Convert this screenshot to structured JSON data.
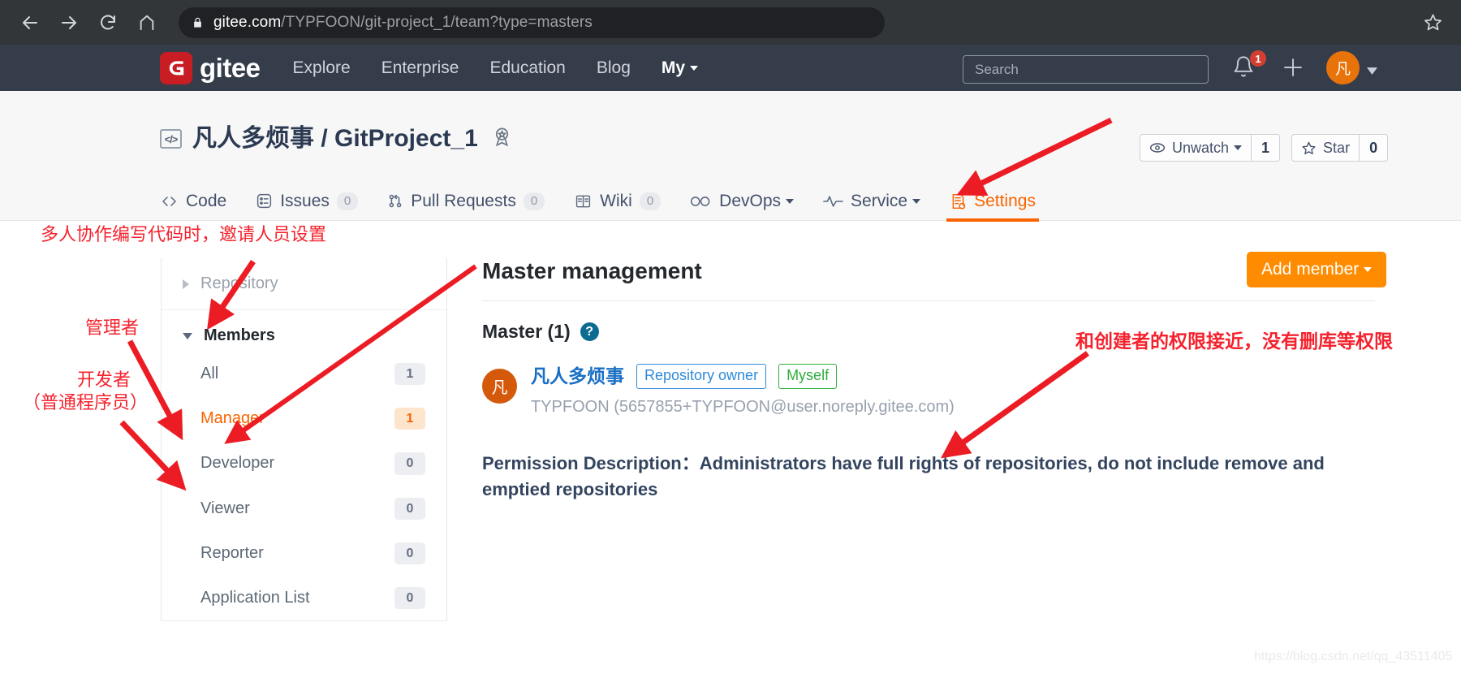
{
  "browser": {
    "url_host": "gitee.com",
    "url_path": "/TYPFOON/git-project_1/team?type=masters",
    "back_icon": "back-arrow-icon",
    "forward_icon": "forward-arrow-icon",
    "reload_icon": "reload-icon",
    "home_icon": "home-icon",
    "lock_icon": "lock-icon",
    "bookmark_icon": "star-outline-icon"
  },
  "header": {
    "logo_text": "gitee",
    "nav": [
      {
        "label": "Explore",
        "bold": false,
        "caret": false
      },
      {
        "label": "Enterprise",
        "bold": false,
        "caret": false
      },
      {
        "label": "Education",
        "bold": false,
        "caret": false
      },
      {
        "label": "Blog",
        "bold": false,
        "caret": false
      },
      {
        "label": "My",
        "bold": true,
        "caret": true
      }
    ],
    "search_placeholder": "Search",
    "search_value": "",
    "notification_count": "1",
    "avatar_initial": "凡"
  },
  "repo": {
    "owner": "凡人多烦事",
    "separator": " / ",
    "name": "GitProject_1",
    "watch_label": "Unwatch",
    "watch_count": "1",
    "star_label": "Star",
    "star_count": "0"
  },
  "tabs": [
    {
      "label": "Code",
      "count": null,
      "icon": "code-icon",
      "caret": false,
      "active": false
    },
    {
      "label": "Issues",
      "count": "0",
      "icon": "issues-icon",
      "caret": false,
      "active": false
    },
    {
      "label": "Pull Requests",
      "count": "0",
      "icon": "pull-request-icon",
      "caret": false,
      "active": false
    },
    {
      "label": "Wiki",
      "count": "0",
      "icon": "wiki-icon",
      "caret": false,
      "active": false
    },
    {
      "label": "DevOps",
      "count": null,
      "icon": "devops-icon",
      "caret": true,
      "active": false
    },
    {
      "label": "Service",
      "count": null,
      "icon": "service-icon",
      "caret": true,
      "active": false
    },
    {
      "label": "Settings",
      "count": null,
      "icon": "settings-icon",
      "caret": false,
      "active": true
    }
  ],
  "sidebar": {
    "repository_label": "Repository",
    "members_label": "Members",
    "items": [
      {
        "label": "All",
        "count": "1",
        "active": false
      },
      {
        "label": "Manager",
        "count": "1",
        "active": true
      },
      {
        "label": "Developer",
        "count": "0",
        "active": false
      },
      {
        "label": "Viewer",
        "count": "0",
        "active": false
      },
      {
        "label": "Reporter",
        "count": "0",
        "active": false
      },
      {
        "label": "Application List",
        "count": "0",
        "active": false
      }
    ]
  },
  "main": {
    "title": "Master management",
    "add_member_label": "Add member",
    "master_count_label": "Master (1)",
    "help_glyph": "?",
    "member": {
      "avatar_initial": "凡",
      "name": "凡人多烦事",
      "tag_owner": "Repository owner",
      "tag_myself": "Myself",
      "email": "TYPFOON (5657855+TYPFOON@user.noreply.gitee.com)"
    },
    "permission_description": "Permission Description：Administrators have full rights of repositories, do not include remove and emptied repositories"
  },
  "annotations": [
    {
      "id": "anno-collab",
      "text": "多人协作编写代码时，邀请人员设置"
    },
    {
      "id": "anno-manager",
      "text": "管理者"
    },
    {
      "id": "anno-dev",
      "text": "开发者"
    },
    {
      "id": "anno-dev-sub",
      "text": "（普通程序员）"
    },
    {
      "id": "anno-perm",
      "text": "和创建者的权限接近，没有删库等权限"
    }
  ],
  "watermark": "https://blog.csdn.net/qq_43511405",
  "colors": {
    "accent_orange": "#fa6400",
    "gitee_red": "#c71d23",
    "header_bg": "#353c4a",
    "annotation_red": "#f5222d"
  }
}
